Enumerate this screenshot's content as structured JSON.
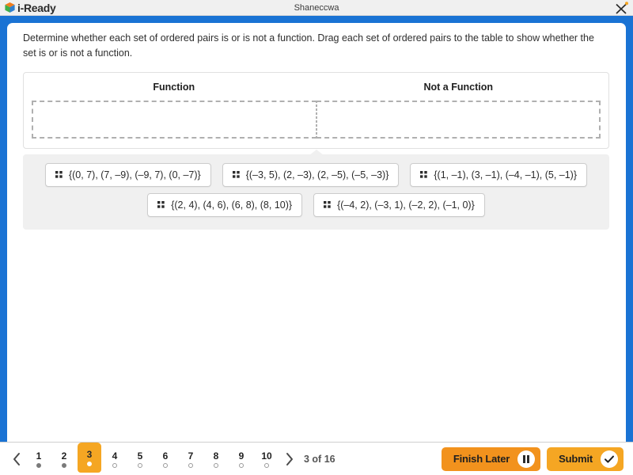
{
  "window": {
    "brand": "i-Ready",
    "brand_icon": "cube-logo-icon",
    "title": "Shaneccwa",
    "close_icon": "close-icon"
  },
  "question": {
    "instruction": "Determine whether each set of ordered pairs is or is not a function. Drag each set of ordered pairs to the table to show whether the set is or is not a function.",
    "columns": [
      {
        "header": "Function"
      },
      {
        "header": "Not a Function"
      }
    ],
    "dropzones": [
      {
        "label": "Function",
        "contents": ""
      },
      {
        "label": "Not a Function",
        "contents": ""
      }
    ],
    "chips": [
      {
        "text": "{(0, 7), (7, –9), (–9, 7), (0, –7)}",
        "handle_icon": "drag-handle-icon",
        "row": 1
      },
      {
        "text": "{(–3, 5), (2, –3), (2, –5), (–5, –3)}",
        "handle_icon": "drag-handle-icon",
        "row": 1
      },
      {
        "text": "{(1, –1), (3, –1), (–4, –1), (5, –1)}",
        "handle_icon": "drag-handle-icon",
        "row": 1
      },
      {
        "text": "{(2, 4), (4, 6), (6, 8), (8, 10)}",
        "handle_icon": "drag-handle-icon",
        "row": 2
      },
      {
        "text": "{(–4, 2), (–3, 1), (–2, 2), (–1, 0)}",
        "handle_icon": "drag-handle-icon",
        "row": 2
      }
    ]
  },
  "nav": {
    "prev_icon": "chevron-left-icon",
    "next_icon": "chevron-right-icon",
    "pages": [
      {
        "number": "1",
        "state": "visited"
      },
      {
        "number": "2",
        "state": "visited"
      },
      {
        "number": "3",
        "state": "active"
      },
      {
        "number": "4",
        "state": "unvisited"
      },
      {
        "number": "5",
        "state": "unvisited"
      },
      {
        "number": "6",
        "state": "unvisited"
      },
      {
        "number": "7",
        "state": "unvisited"
      },
      {
        "number": "8",
        "state": "unvisited"
      },
      {
        "number": "9",
        "state": "unvisited"
      },
      {
        "number": "10",
        "state": "unvisited"
      }
    ],
    "counter": "3 of 16",
    "finish_later_label": "Finish Later",
    "finish_later_icon": "pause-icon",
    "submit_label": "Submit",
    "submit_icon": "check-icon"
  },
  "colors": {
    "frame_blue": "#1a73d4",
    "accent_orange": "#f5a623",
    "finish_orange": "#f2921d",
    "tray_gray": "#f0f0f0",
    "dash_gray": "#b0b0b0"
  }
}
